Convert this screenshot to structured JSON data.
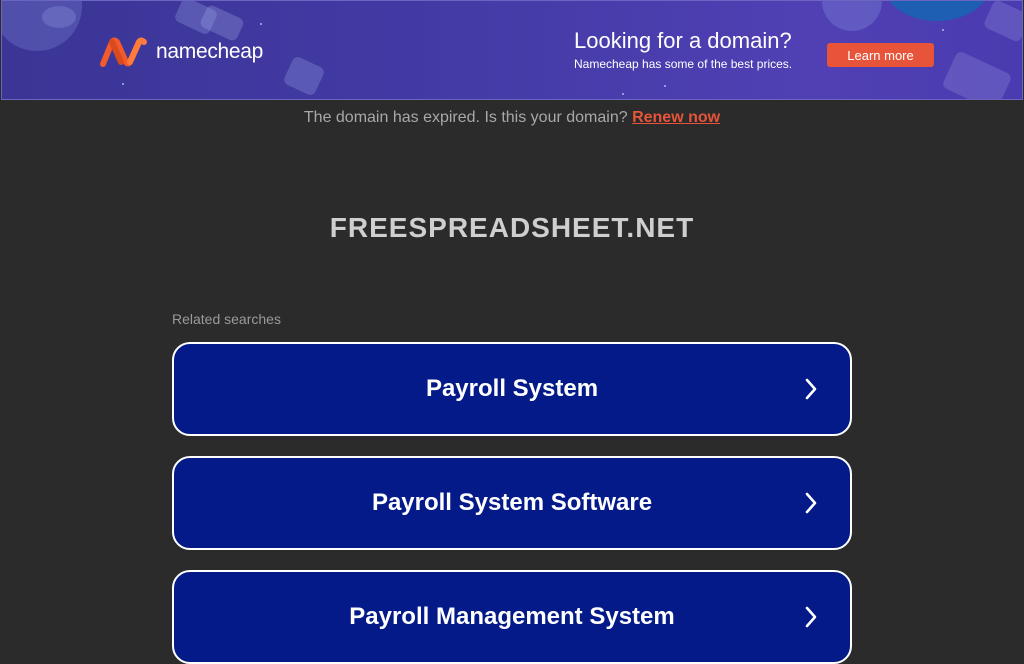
{
  "banner": {
    "brand": "namecheap",
    "title": "Looking for a domain?",
    "subtitle": "Namecheap has some of the best prices.",
    "cta_label": "Learn more"
  },
  "notice": {
    "text": "The domain has expired. Is this your domain?",
    "link_label": "Renew now"
  },
  "domain": {
    "name": "FREESPREADSHEET.NET"
  },
  "related": {
    "label": "Related searches",
    "items": [
      {
        "label": "Payroll System"
      },
      {
        "label": "Payroll System Software"
      },
      {
        "label": "Payroll Management System"
      }
    ]
  },
  "colors": {
    "banner_bg": "#433ba6",
    "accent": "#e8543a",
    "page_bg": "#2b2b2b",
    "button_bg": "#041a88"
  },
  "icons": {
    "logo": "namecheap-logo-icon",
    "chevron": "chevron-right-icon"
  }
}
